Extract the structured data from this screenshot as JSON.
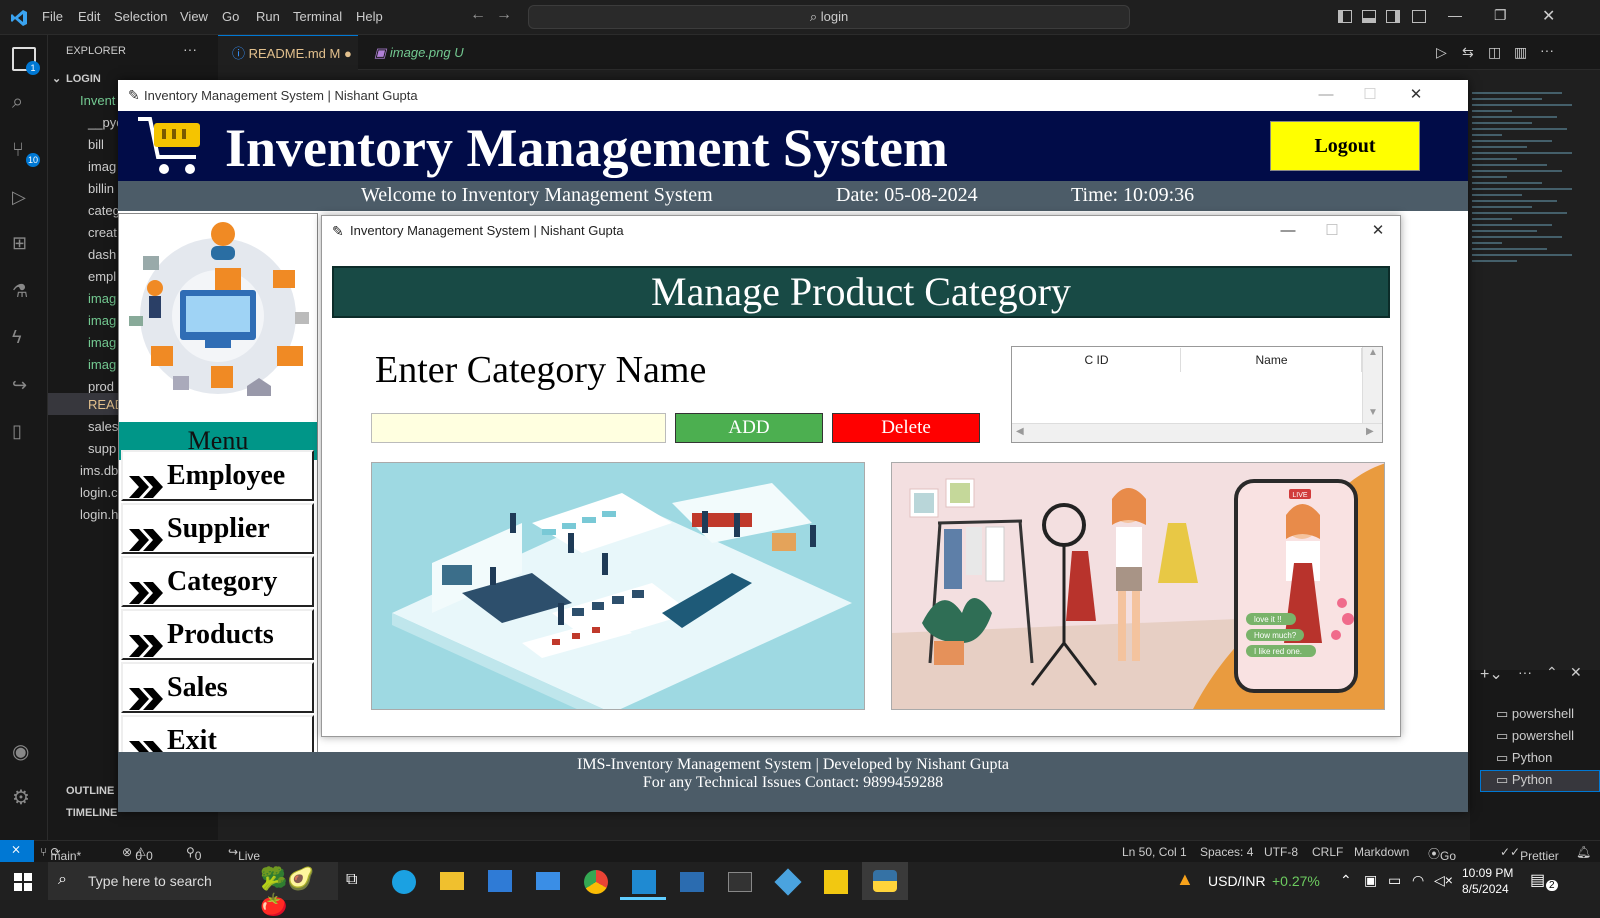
{
  "vscode": {
    "menu": [
      "File",
      "Edit",
      "Selection",
      "View",
      "Go",
      "Run",
      "Terminal",
      "Help"
    ],
    "search_text": "login",
    "explorer_title": "EXPLORER",
    "root_folder": "LOGIN",
    "tree_items": [
      "Invent",
      "__pyc",
      "bill",
      "imag",
      "billin",
      "categ",
      "creat",
      "dash",
      "empl",
      "imag",
      "imag",
      "imag",
      "imag",
      "prod",
      "READ",
      "sales",
      "supp",
      "ims.db",
      "login.c",
      "login.h"
    ],
    "outline_label": "OUTLINE",
    "timeline_label": "TIMELINE",
    "tabs": [
      {
        "label": "README.md",
        "suffix": "M"
      },
      {
        "label": "image.png",
        "suffix": "U"
      }
    ],
    "badges": {
      "explorer": "1",
      "scm": "10"
    },
    "terminals": [
      "powershell",
      "powershell",
      "Python",
      "Python"
    ],
    "status": {
      "branch": "main*",
      "problems": "0",
      "warnings": "0",
      "ports": "0",
      "live_share": "Live Share",
      "position": "Ln 50, Col 1",
      "spaces": "Spaces: 4",
      "encoding": "UTF-8",
      "eol": "CRLF",
      "language": "Markdown",
      "go_live": "Go Live",
      "prettier": "Prettier"
    }
  },
  "taskbar": {
    "search_placeholder": "Type here to search",
    "ticker": "USD/INR",
    "ticker_change": "+0.27%",
    "time": "10:09 PM",
    "date": "8/5/2024",
    "notifications": "2"
  },
  "app": {
    "window_title": "Inventory Management System | Nishant Gupta",
    "title": "Inventory Management System",
    "logout_label": "Logout",
    "welcome": "Welcome to Inventory Management System",
    "date": "Date: 05-08-2024",
    "time": "Time: 10:09:36",
    "menu_header": "Menu",
    "menu_items": [
      "Employee",
      "Supplier",
      "Category",
      "Products",
      "Sales",
      "Exit"
    ],
    "footer_line1": "IMS-Inventory Management System | Developed by Nishant Gupta",
    "footer_line2": "For any Technical Issues Contact: 9899459288"
  },
  "category_window": {
    "window_title": "Inventory Management System | Nishant Gupta",
    "heading": "Manage Product Category",
    "label": "Enter Category Name",
    "input_value": "",
    "add_label": "ADD",
    "delete_label": "Delete",
    "columns": [
      "C ID",
      "Name"
    ],
    "image_badge": "LIVE",
    "chat_bubbles": [
      "love it !!",
      "How much?",
      "I like red one."
    ]
  },
  "colors": {
    "banner": "#010c48",
    "logout": "#ffff00",
    "info_bar": "#4c5c68",
    "menu_header": "#009688",
    "category_header": "#184a45",
    "add": "#4caf50",
    "delete": "#ff0000",
    "input_bg": "#ffffe0"
  }
}
